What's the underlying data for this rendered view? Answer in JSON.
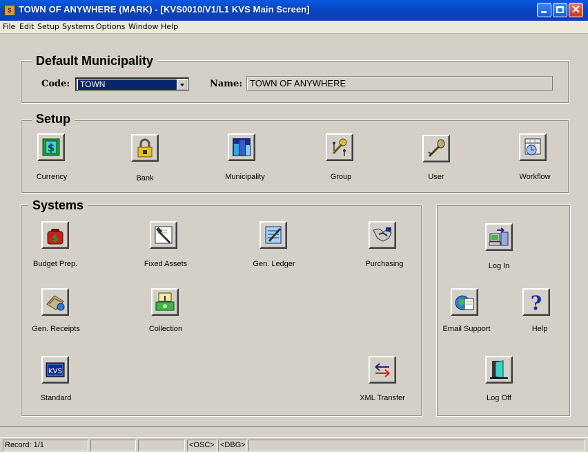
{
  "window": {
    "title": "TOWN OF ANYWHERE (MARK) - [KVS0010/V1/L1 KVS Main Screen]",
    "icon": "app-icon",
    "controls": [
      "minimize-icon",
      "maximize-icon",
      "close-icon"
    ]
  },
  "menu": {
    "items": [
      "File",
      "Edit",
      "Setup",
      "Systems",
      "Options",
      "Window",
      "Help"
    ]
  },
  "municipality": {
    "section_title": "Default Municipality",
    "code_label": "Code:",
    "code_value": "TOWN",
    "name_label": "Name:",
    "name_value": "TOWN OF ANYWHERE"
  },
  "setup": {
    "section_title": "Setup",
    "buttons": [
      {
        "label": "Currency",
        "icon": "currency-icon"
      },
      {
        "label": "Bank",
        "icon": "bank-lock-icon"
      },
      {
        "label": "Municipality",
        "icon": "municipality-buildings-icon"
      },
      {
        "label": "Group",
        "icon": "group-keys-icon"
      },
      {
        "label": "User",
        "icon": "user-key-icon"
      },
      {
        "label": "Workflow",
        "icon": "workflow-calendar-icon"
      }
    ]
  },
  "systems": {
    "section_title": "Systems",
    "buttons": [
      {
        "label": "Budget Prep.",
        "icon": "budget-bag-icon"
      },
      {
        "label": "Fixed Assets",
        "icon": "fixed-assets-hammer-icon"
      },
      {
        "label": "Gen. Ledger",
        "icon": "ledger-pencil-icon"
      },
      {
        "label": "Purchasing",
        "icon": "purchasing-handshake-icon"
      },
      {
        "label": "Gen. Receipts",
        "icon": "receipts-icon"
      },
      {
        "label": "Collection",
        "icon": "collection-money-icon"
      },
      {
        "label": "Standard",
        "icon": "kvs-standard-icon"
      },
      {
        "label": "XML Transfer",
        "icon": "transfer-arrows-icon"
      }
    ]
  },
  "side_panel": {
    "buttons": [
      {
        "label": "Log In",
        "icon": "login-computer-icon"
      },
      {
        "label": "Email Support",
        "icon": "email-support-icon"
      },
      {
        "label": "Help",
        "icon": "help-question-icon"
      },
      {
        "label": "Log Off",
        "icon": "logoff-door-icon"
      }
    ]
  },
  "status_bar": {
    "record": "Record: 1/1",
    "osc": "<OSC>",
    "dbg": "<DBG>"
  },
  "colors": {
    "titlebar": "#0846c2",
    "selection": "#0a246a",
    "face": "#d4d0c8"
  }
}
